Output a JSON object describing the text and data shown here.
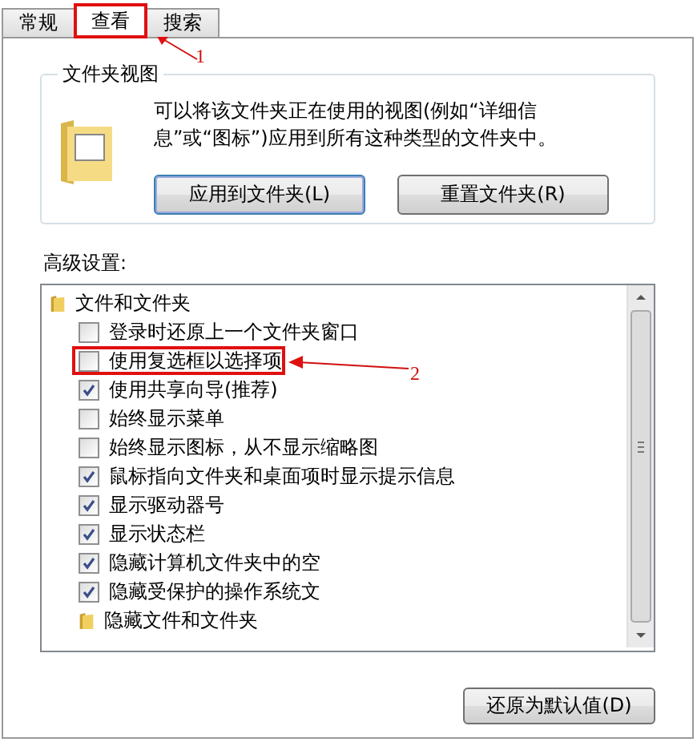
{
  "tabs": [
    {
      "label": "常规",
      "selected": false
    },
    {
      "label": "查看",
      "selected": true,
      "annotation": "1"
    },
    {
      "label": "搜索",
      "selected": false
    }
  ],
  "folder_views": {
    "title": "文件夹视图",
    "description": "可以将该文件夹正在使用的视图(例如“详细信息”或“图标”)应用到所有这种类型的文件夹中。",
    "buttons": [
      {
        "label": "应用到文件夹(L)",
        "focused": true
      },
      {
        "label": "重置文件夹(R)",
        "focused": false
      }
    ]
  },
  "advanced": {
    "title": "高级设置:",
    "items": [
      {
        "kind": "folder",
        "label": "文件和文件夹",
        "children": [
          {
            "kind": "checkbox",
            "label": "登录时还原上一个文件夹窗口",
            "checked": false
          },
          {
            "kind": "checkbox",
            "label": "使用复选框以选择项",
            "checked": false,
            "annotation": "2"
          },
          {
            "kind": "checkbox",
            "label": "使用共享向导(推荐)",
            "checked": true
          },
          {
            "kind": "checkbox",
            "label": "始终显示菜单",
            "checked": false
          },
          {
            "kind": "checkbox",
            "label": "始终显示图标，从不显示缩略图",
            "checked": false
          },
          {
            "kind": "checkbox",
            "label": "鼠标指向文件夹和桌面项时显示提示信息",
            "checked": true
          },
          {
            "kind": "checkbox",
            "label": "显示驱动器号",
            "checked": true
          },
          {
            "kind": "checkbox",
            "label": "显示状态栏",
            "checked": true
          },
          {
            "kind": "checkbox",
            "label": "隐藏计算机文件夹中的空",
            "checked": true
          },
          {
            "kind": "checkbox",
            "label": "隐藏受保护的操作系统文",
            "checked": true
          },
          {
            "kind": "folder",
            "label": "隐藏文件和文件夹"
          }
        ]
      }
    ]
  },
  "restore_button": {
    "label": "还原为默认值(D)"
  }
}
